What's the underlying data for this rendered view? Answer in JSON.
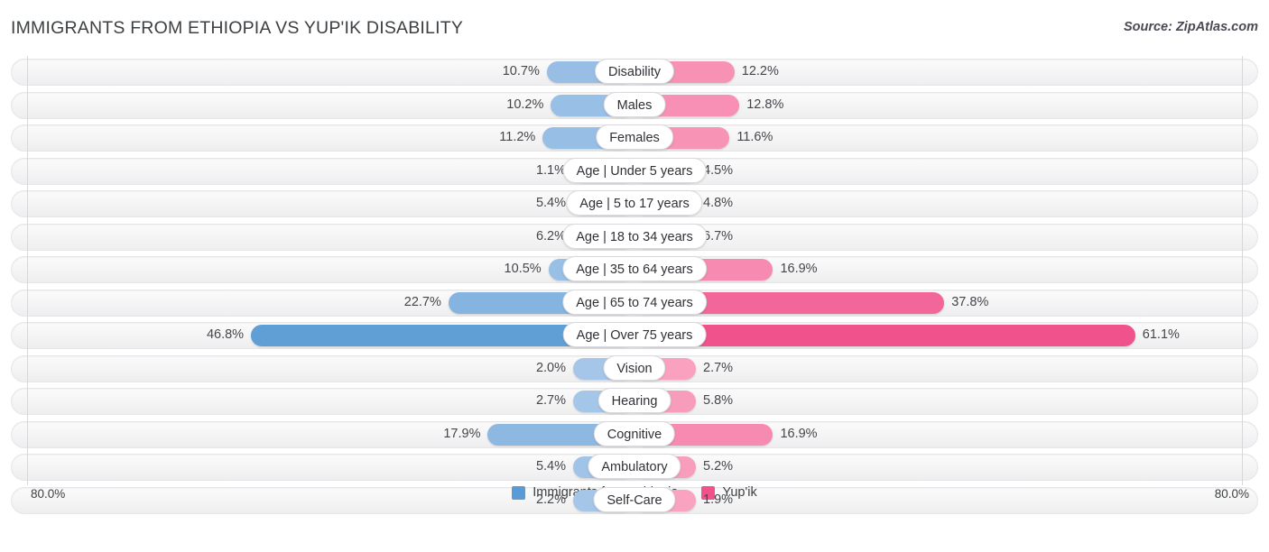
{
  "header": {
    "title": "IMMIGRANTS FROM ETHIOPIA VS YUP'IK DISABILITY",
    "source": "Source: ZipAtlas.com"
  },
  "axis": {
    "left_label": "80.0%",
    "right_label": "80.0%",
    "max": 80.0
  },
  "legend": {
    "items": [
      {
        "label": "Immigrants from Ethiopia",
        "color": "#5b9bd5"
      },
      {
        "label": "Yup'ik",
        "color": "#f0528c"
      }
    ]
  },
  "chart_data": {
    "type": "bar",
    "orientation": "horizontal-diverging",
    "title": "IMMIGRANTS FROM ETHIOPIA VS YUP'IK DISABILITY",
    "xlabel": "",
    "ylabel": "",
    "xlim": [
      0,
      80.0
    ],
    "grid": false,
    "legend_position": "bottom-center",
    "categories": [
      "Disability",
      "Males",
      "Females",
      "Age | Under 5 years",
      "Age | 5 to 17 years",
      "Age | 18 to 34 years",
      "Age | 35 to 64 years",
      "Age | 65 to 74 years",
      "Age | Over 75 years",
      "Vision",
      "Hearing",
      "Cognitive",
      "Ambulatory",
      "Self-Care"
    ],
    "series": [
      {
        "name": "Immigrants from Ethiopia",
        "color": "#5b9bd5",
        "values": [
          10.7,
          10.2,
          11.2,
          1.1,
          5.4,
          6.2,
          10.5,
          22.7,
          46.8,
          2.0,
          2.7,
          17.9,
          5.4,
          2.2
        ],
        "labels": [
          "10.7%",
          "10.2%",
          "11.2%",
          "1.1%",
          "5.4%",
          "6.2%",
          "10.5%",
          "22.7%",
          "46.8%",
          "2.0%",
          "2.7%",
          "17.9%",
          "5.4%",
          "2.2%"
        ]
      },
      {
        "name": "Yup'ik",
        "color": "#f0528c",
        "values": [
          12.2,
          12.8,
          11.6,
          4.5,
          4.8,
          6.7,
          16.9,
          37.8,
          61.1,
          2.7,
          5.8,
          16.9,
          5.2,
          1.9
        ],
        "labels": [
          "12.2%",
          "12.8%",
          "11.6%",
          "4.5%",
          "4.8%",
          "6.7%",
          "16.9%",
          "37.8%",
          "61.1%",
          "2.7%",
          "5.8%",
          "16.9%",
          "5.2%",
          "1.9%"
        ]
      }
    ]
  }
}
